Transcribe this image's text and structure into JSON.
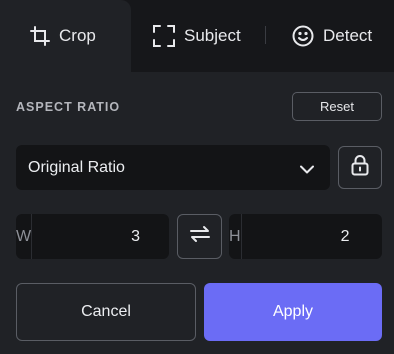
{
  "tabs": [
    {
      "label": "Crop",
      "icon": "crop-icon",
      "active": true
    },
    {
      "label": "Subject",
      "icon": "subject-frame-icon",
      "active": false
    },
    {
      "label": "Detect",
      "icon": "smiley-face-icon",
      "active": false
    }
  ],
  "aspect_ratio": {
    "title": "ASPECT RATIO",
    "reset_label": "Reset",
    "selected": "Original Ratio",
    "lock_icon": "lock-icon"
  },
  "dimensions": {
    "width_label": "W",
    "width_value": "3",
    "height_label": "H",
    "height_value": "2",
    "swap_icon": "swap-arrows-icon"
  },
  "actions": {
    "cancel_label": "Cancel",
    "apply_label": "Apply"
  },
  "colors": {
    "background": "#202226",
    "tabbar": "#16171a",
    "input_bg": "#131416",
    "accent": "#6b6cf5",
    "border": "#5a5d64"
  }
}
